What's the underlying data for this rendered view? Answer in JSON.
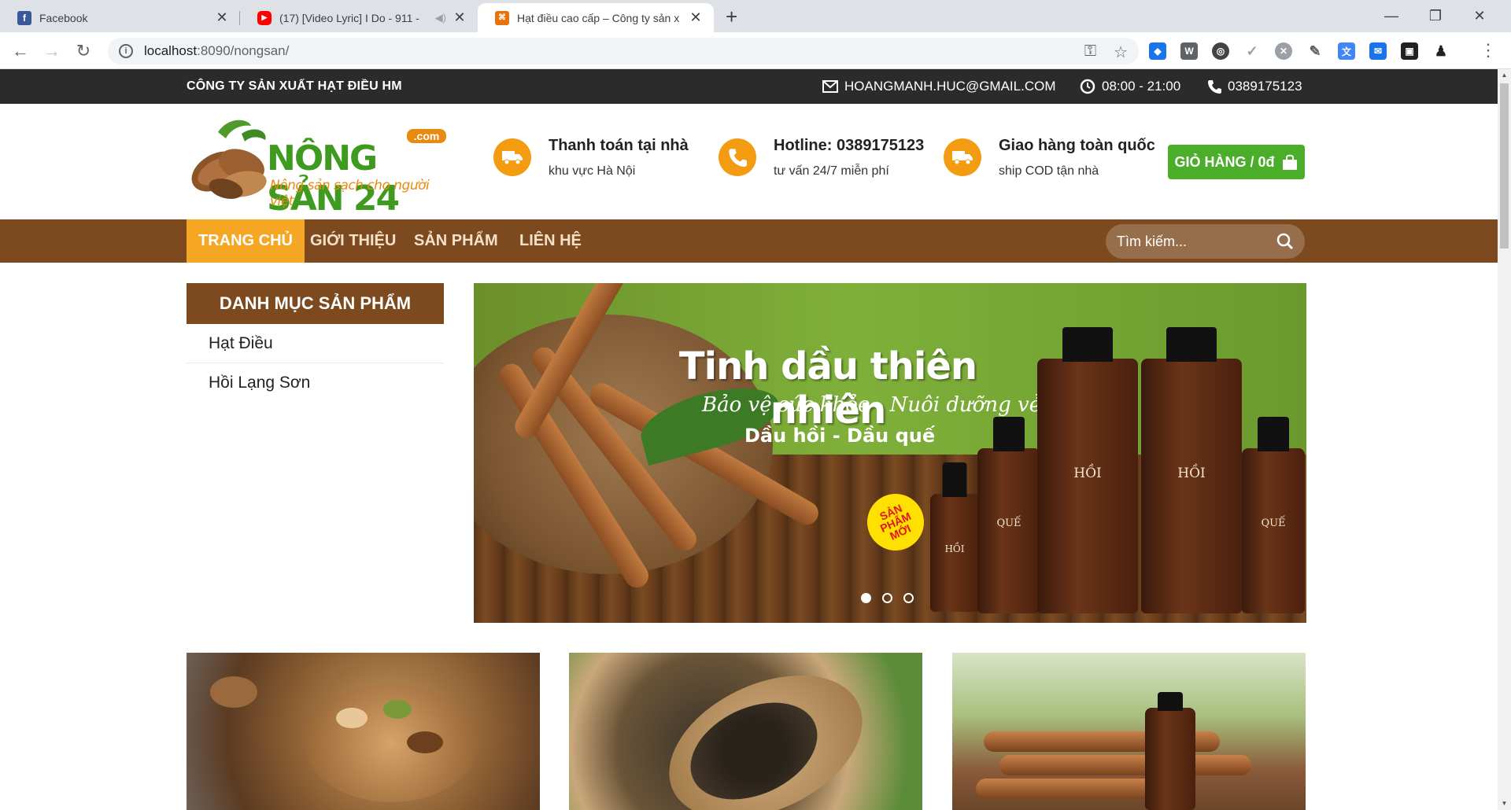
{
  "browser": {
    "tabs": [
      {
        "title": "Facebook",
        "icon": "facebook-icon"
      },
      {
        "title": "(17) [Video Lyric] I Do - 911 -",
        "icon": "youtube-icon"
      },
      {
        "title": "Hạt điều cao cấp – Công ty sản x",
        "icon": "site-icon"
      }
    ],
    "url_host": "localhost",
    "url_path": ":8090/nongsan/"
  },
  "topbar": {
    "company": "CÔNG TY SẢN XUẤT HẠT ĐIỀU HM",
    "email": "HOANGMANH.HUC@GMAIL.COM",
    "hours": "08:00 - 21:00",
    "phone": "0389175123"
  },
  "header": {
    "logo_brand": "NÔNG SẢN 24",
    "logo_dotcom": ".com",
    "logo_slogan": "Nông sản sạch cho người việt",
    "features": [
      {
        "title": "Thanh toán tại nhà",
        "subtitle": "khu vực Hà Nội",
        "icon": "delivery-truck-icon"
      },
      {
        "title": "Hotline: 0389175123",
        "subtitle": "tư vấn 24/7 miễn phí",
        "icon": "phone-icon"
      },
      {
        "title": "Giao hàng toàn quốc",
        "subtitle": "ship COD tận nhà",
        "icon": "delivery-truck-icon"
      }
    ],
    "cart_label": "GIỎ HÀNG / 0đ"
  },
  "nav": {
    "items": [
      "TRANG CHỦ",
      "GIỚI THIỆU",
      "SẢN PHẨM",
      "LIÊN HỆ"
    ],
    "active_index": 0,
    "search_placeholder": "Tìm kiếm..."
  },
  "sidebar": {
    "title": "DANH MỤC SẢN PHẨM",
    "items": [
      "Hạt Điều",
      "Hồi Lạng Sơn"
    ]
  },
  "banner": {
    "title": "Tinh dầu thiên nhiên",
    "subtitle": "Bảo vệ sức khỏe - Nuôi dưỡng vẻ đẹp",
    "subtitle2": "Dầu hồi - Dầu quế",
    "badge": "SẢN PHẨM MỚI",
    "bottle_labels": [
      "HỒI",
      "QUẾ",
      "HỒI",
      "HỒI",
      "QUẾ"
    ],
    "slide_count": 3,
    "active_slide": 0
  },
  "colors": {
    "brown": "#7c4a1e",
    "orange": "#f5a623",
    "green": "#4bae2a",
    "topbar": "#2b2b2b"
  }
}
